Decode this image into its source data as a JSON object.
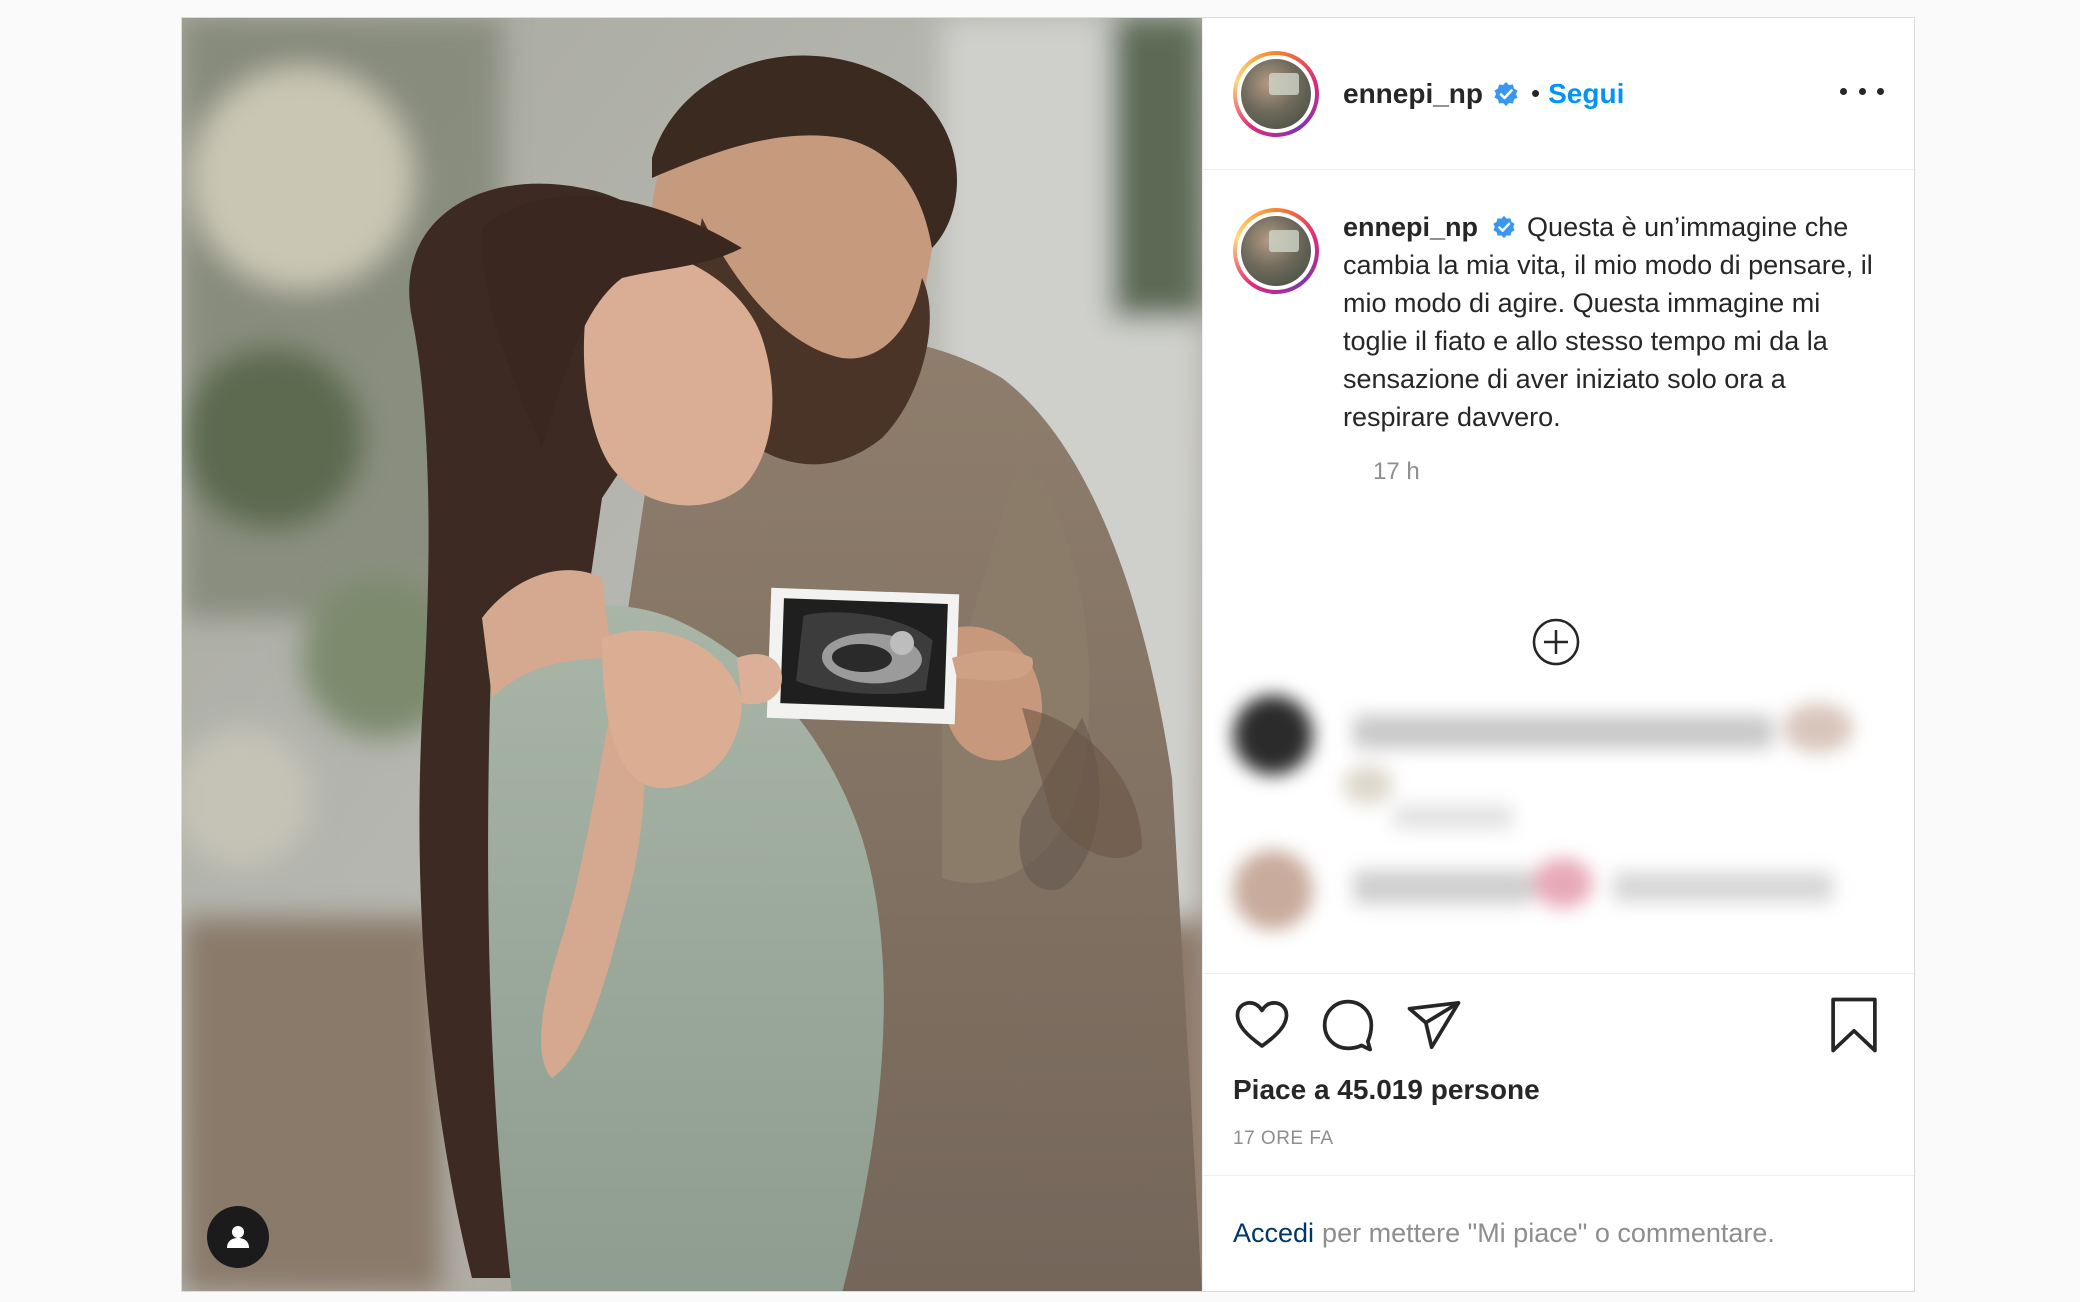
{
  "post": {
    "username": "ennepi_np",
    "follow_label": "Segui",
    "separator": "•",
    "caption_username": "ennepi_np",
    "caption_text": "Questa è un’immagine che cambia la mia vita, il mio modo di pensare, il mio modo di agire. Questa immagine mi toglie il fiato e allo stesso tempo mi da la sensazione di aver iniziato solo ora a respirare davvero.",
    "timestamp": "17 h",
    "likes": "Piace a 45.019 persone",
    "time_ago": "17 ORE FA",
    "login_link": "Accedi",
    "login_prompt": "per mettere \"Mi piace\" o commentare."
  },
  "icons": {
    "more": "more-options-icon",
    "verified": "verified-badge-icon",
    "load_more": "plus-circle-icon",
    "like": "heart-icon",
    "comment": "comment-bubble-icon",
    "share": "paper-plane-icon",
    "save": "bookmark-icon",
    "user_tag": "user-tag-icon"
  },
  "colors": {
    "link_blue": "#0095f6",
    "dark_link": "#00376b",
    "muted": "#8e8e8e",
    "text": "#262626"
  }
}
